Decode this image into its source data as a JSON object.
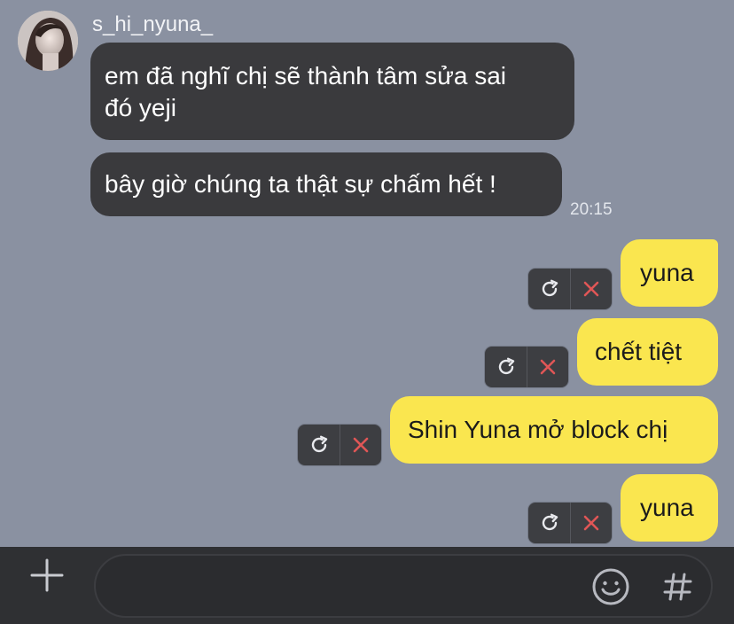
{
  "header": {
    "sender": "s_hi_nyuna_",
    "avatar_alt": "profile photo"
  },
  "messages": {
    "incoming": [
      {
        "text_line1": "em đã nghĩ chị sẽ thành tâm sửa sai",
        "text_line2": "đó yeji"
      },
      {
        "text": "bây giờ chúng ta thật sự chấm hết !",
        "time": "20:15"
      }
    ],
    "outgoing": [
      {
        "text": "yuna"
      },
      {
        "text": "chết tiệt"
      },
      {
        "text": "Shin Yuna mở block chị"
      },
      {
        "text": "yuna"
      }
    ]
  },
  "composer": {
    "placeholder": "",
    "value": ""
  },
  "icons": {
    "retry": "retry-icon",
    "delete": "delete-icon",
    "plus": "plus-icon",
    "emoji": "emoji-icon",
    "hash": "hash-icon"
  },
  "colors": {
    "background": "#8a91a1",
    "incoming_bubble": "#3a3a3d",
    "outgoing_bubble": "#fae64f",
    "composer_bg": "#2f3033",
    "delete_red": "#e05656"
  }
}
